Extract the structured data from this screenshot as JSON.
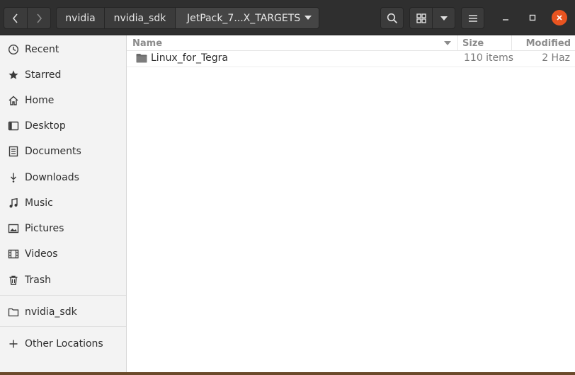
{
  "header": {
    "breadcrumbs": [
      "nvidia",
      "nvidia_sdk",
      "JetPack_7...X_TARGETS"
    ]
  },
  "sidebar": {
    "items": [
      {
        "label": "Recent",
        "icon": "clock-icon"
      },
      {
        "label": "Starred",
        "icon": "star-icon"
      },
      {
        "label": "Home",
        "icon": "home-icon"
      },
      {
        "label": "Desktop",
        "icon": "desktop-icon"
      },
      {
        "label": "Documents",
        "icon": "document-icon"
      },
      {
        "label": "Downloads",
        "icon": "download-icon"
      },
      {
        "label": "Music",
        "icon": "music-icon"
      },
      {
        "label": "Pictures",
        "icon": "picture-icon"
      },
      {
        "label": "Videos",
        "icon": "video-icon"
      },
      {
        "label": "Trash",
        "icon": "trash-icon"
      }
    ],
    "bookmarks": [
      {
        "label": "nvidia_sdk",
        "icon": "folder-icon"
      }
    ],
    "other": {
      "label": "Other Locations",
      "icon": "plus-icon"
    }
  },
  "columns": {
    "name": "Name",
    "size": "Size",
    "modified": "Modified"
  },
  "files": [
    {
      "name": "Linux_for_Tegra",
      "size": "110 items",
      "modified": "2 Haz",
      "icon": "folder-icon"
    }
  ],
  "colors": {
    "close_button": "#e95420",
    "headerbar": "#2f2f2f"
  }
}
